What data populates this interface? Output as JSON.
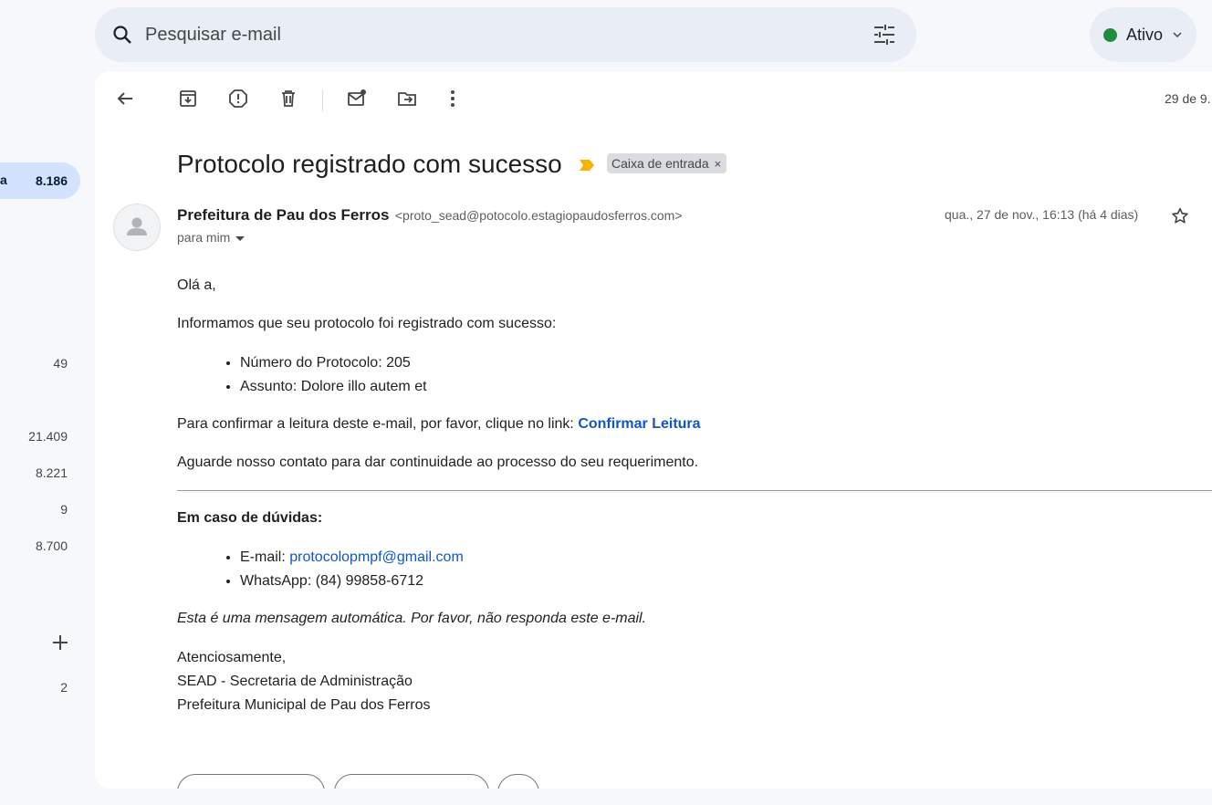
{
  "sidebar": {
    "active": {
      "label": "a",
      "count": "8.186"
    },
    "counts": [
      "49",
      "21.409",
      "8.221",
      "9",
      "8.700",
      "2"
    ]
  },
  "search": {
    "placeholder": "Pesquisar e-mail"
  },
  "status": {
    "label": "Ativo",
    "color": "#1e8e3e"
  },
  "toolbar": {
    "page_info": "29 de 9."
  },
  "email": {
    "subject": "Protocolo registrado com sucesso",
    "label": "Caixa de entrada",
    "label_close": "×",
    "sender_name": "Prefeitura de Pau dos Ferros",
    "sender_email": "<proto_sead@potocolo.estagiopaudosferros.com>",
    "to": "para mim",
    "date": "qua., 27 de nov., 16:13 (há 4 dias)",
    "greeting": "Olá a,",
    "intro": "Informamos que seu protocolo foi registrado com sucesso:",
    "details": [
      "Número do Protocolo: 205",
      "Assunto: Dolore illo autem et"
    ],
    "confirm_text": "Para confirmar a leitura deste e-mail, por favor, clique no link: ",
    "confirm_link": "Confirmar Leitura",
    "wait_text": "Aguarde nosso contato para dar continuidade ao processo do seu requerimento.",
    "doubts_title": "Em caso de dúvidas:",
    "contact_email_label": "E-mail: ",
    "contact_email": "protocolopmpf@gmail.com",
    "contact_whatsapp": "WhatsApp: (84) 99858-6712",
    "auto_notice": "Esta é uma mensagem automática. Por favor, não responda este e-mail.",
    "signoff": "Atenciosamente,",
    "sig_line1": "SEAD - Secretaria de Administração",
    "sig_line2": "Prefeitura Municipal de Pau dos Ferros"
  }
}
